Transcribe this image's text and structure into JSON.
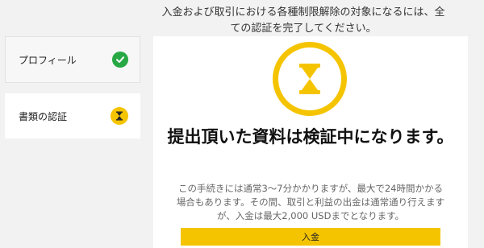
{
  "intro_text": "入金および取引における各種制限解除の対象になるには、全ての認証を完了してください。",
  "sidebar": {
    "items": [
      {
        "label": "プロフィール",
        "status": "complete"
      },
      {
        "label": "書類の認証",
        "status": "pending"
      }
    ]
  },
  "card": {
    "title": "提出頂いた資料は検証中になります。",
    "description": "この手続きには通常3〜7分かかりますが、最大で24時間かかる場合もあります。その間、取引と利益の出金は通常通り行えますが、入金は最大2,000 USDまでとなります。",
    "button_label": "入金"
  },
  "colors": {
    "accent": "#f5c400",
    "success": "#27a844"
  }
}
